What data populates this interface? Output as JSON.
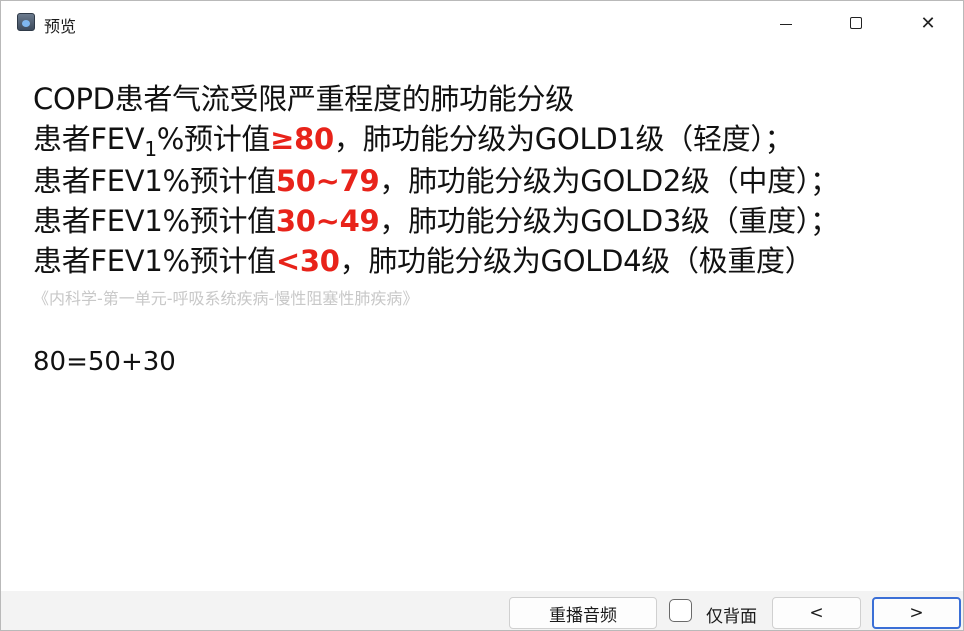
{
  "window": {
    "title": "预览",
    "close_glyph": "✕"
  },
  "content": {
    "heading": "COPD患者气流受限严重程度的肺功能分级",
    "lines": [
      {
        "prefix": "患者FEV",
        "sub": "1",
        "mid": "%预计值",
        "value": "≥80",
        "suffix": "，肺功能分级为GOLD1级（轻度）；"
      },
      {
        "prefix": "患者FEV1%预计值",
        "value": "50~79",
        "suffix": "，肺功能分级为GOLD2级（中度）；"
      },
      {
        "prefix": "患者FEV1%预计值",
        "value": "30~49",
        "suffix": "，肺功能分级为GOLD3级（重度）；"
      },
      {
        "prefix": "患者FEV1%预计值",
        "value": "<30",
        "suffix": "，肺功能分级为GOLD4级（极重度）"
      }
    ],
    "source": "《内科学-第一单元-呼吸系统疾病-慢性阻塞性肺疾病》",
    "formula": "80=50+30"
  },
  "bottom": {
    "replay_label": "重播音频",
    "back_only_label": "仅背面",
    "back_only_checked": false,
    "prev_label": "<",
    "next_label": ">"
  },
  "colors": {
    "highlight": "#e8231a",
    "source_text": "#c8c8c8",
    "focus_border": "#3b6fd6"
  },
  "icons": {
    "app": "app-icon",
    "minimize": "minimize-icon",
    "maximize": "maximize-icon",
    "close": "close-icon"
  }
}
